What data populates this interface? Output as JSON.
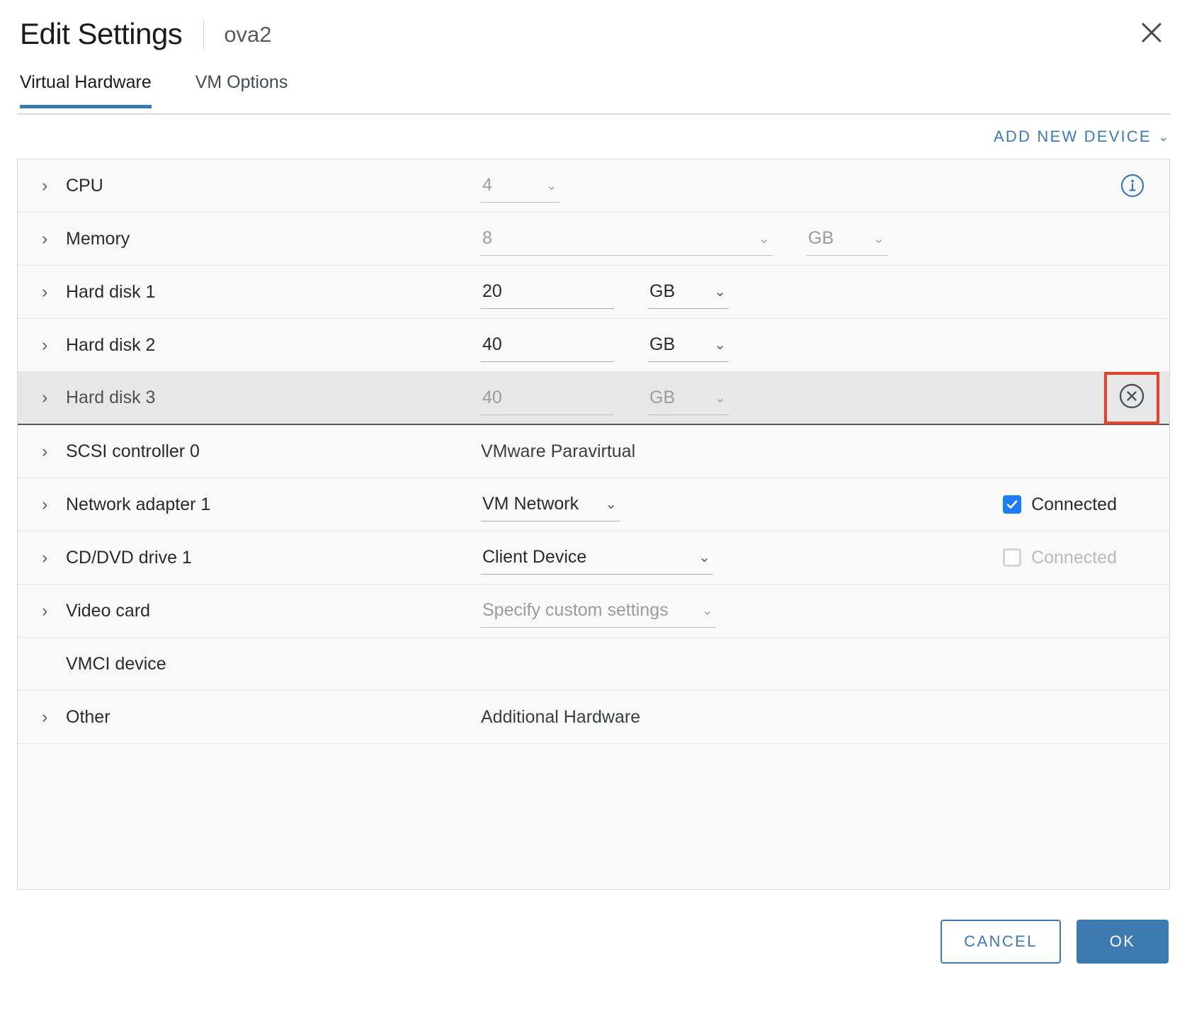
{
  "header": {
    "title": "Edit Settings",
    "subtitle": "ova2",
    "close_label": "close-icon"
  },
  "tabs": [
    {
      "label": "Virtual Hardware",
      "active": true
    },
    {
      "label": "VM Options",
      "active": false
    }
  ],
  "toolbar": {
    "add_device_label": "ADD NEW DEVICE",
    "add_device_caret": "⌄"
  },
  "rows": [
    {
      "name": "CPU",
      "expandable": true,
      "value": "4",
      "value_muted": true,
      "caret": "⌄",
      "right_widget": "info"
    },
    {
      "name": "Memory",
      "expandable": true,
      "value": "8",
      "value_muted": true,
      "caret": "⌄",
      "unit": "GB",
      "unit_muted": true
    },
    {
      "name": "Hard disk 1",
      "expandable": true,
      "value": "20",
      "value_muted": false,
      "unit": "GB",
      "unit_muted": false,
      "caret": "⌄"
    },
    {
      "name": "Hard disk 2",
      "expandable": true,
      "value": "40",
      "value_muted": false,
      "unit": "GB",
      "unit_muted": false,
      "caret": "⌄"
    },
    {
      "name": "Hard disk 3",
      "expandable": true,
      "value": "40",
      "value_muted": true,
      "unit": "GB",
      "unit_muted": true,
      "caret": "⌄",
      "selected": true,
      "right_widget": "remove"
    },
    {
      "name": "SCSI controller 0",
      "expandable": true,
      "text": "VMware Paravirtual"
    },
    {
      "name": "Network adapter 1",
      "expandable": true,
      "value": "VM Network",
      "caret": "⌄",
      "checkbox": {
        "label": "Connected",
        "checked": true,
        "disabled": false
      }
    },
    {
      "name": "CD/DVD drive 1",
      "expandable": true,
      "value": "Client Device",
      "caret": "⌄",
      "checkbox": {
        "label": "Connected",
        "checked": false,
        "disabled": true
      }
    },
    {
      "name": "Video card",
      "expandable": true,
      "value": "Specify custom settings",
      "value_muted": true,
      "caret": "⌄"
    },
    {
      "name": "VMCI device",
      "expandable": false
    },
    {
      "name": "Other",
      "expandable": true,
      "text": "Additional Hardware"
    }
  ],
  "footer": {
    "cancel_label": "CANCEL",
    "ok_label": "OK"
  },
  "colors": {
    "accent_blue": "#3d7ab0",
    "checkbox_blue": "#1c7ef2",
    "highlight_red": "#e8412a",
    "selected_row_bg": "#e7e7e7",
    "panel_bg": "#f9f9f9"
  }
}
